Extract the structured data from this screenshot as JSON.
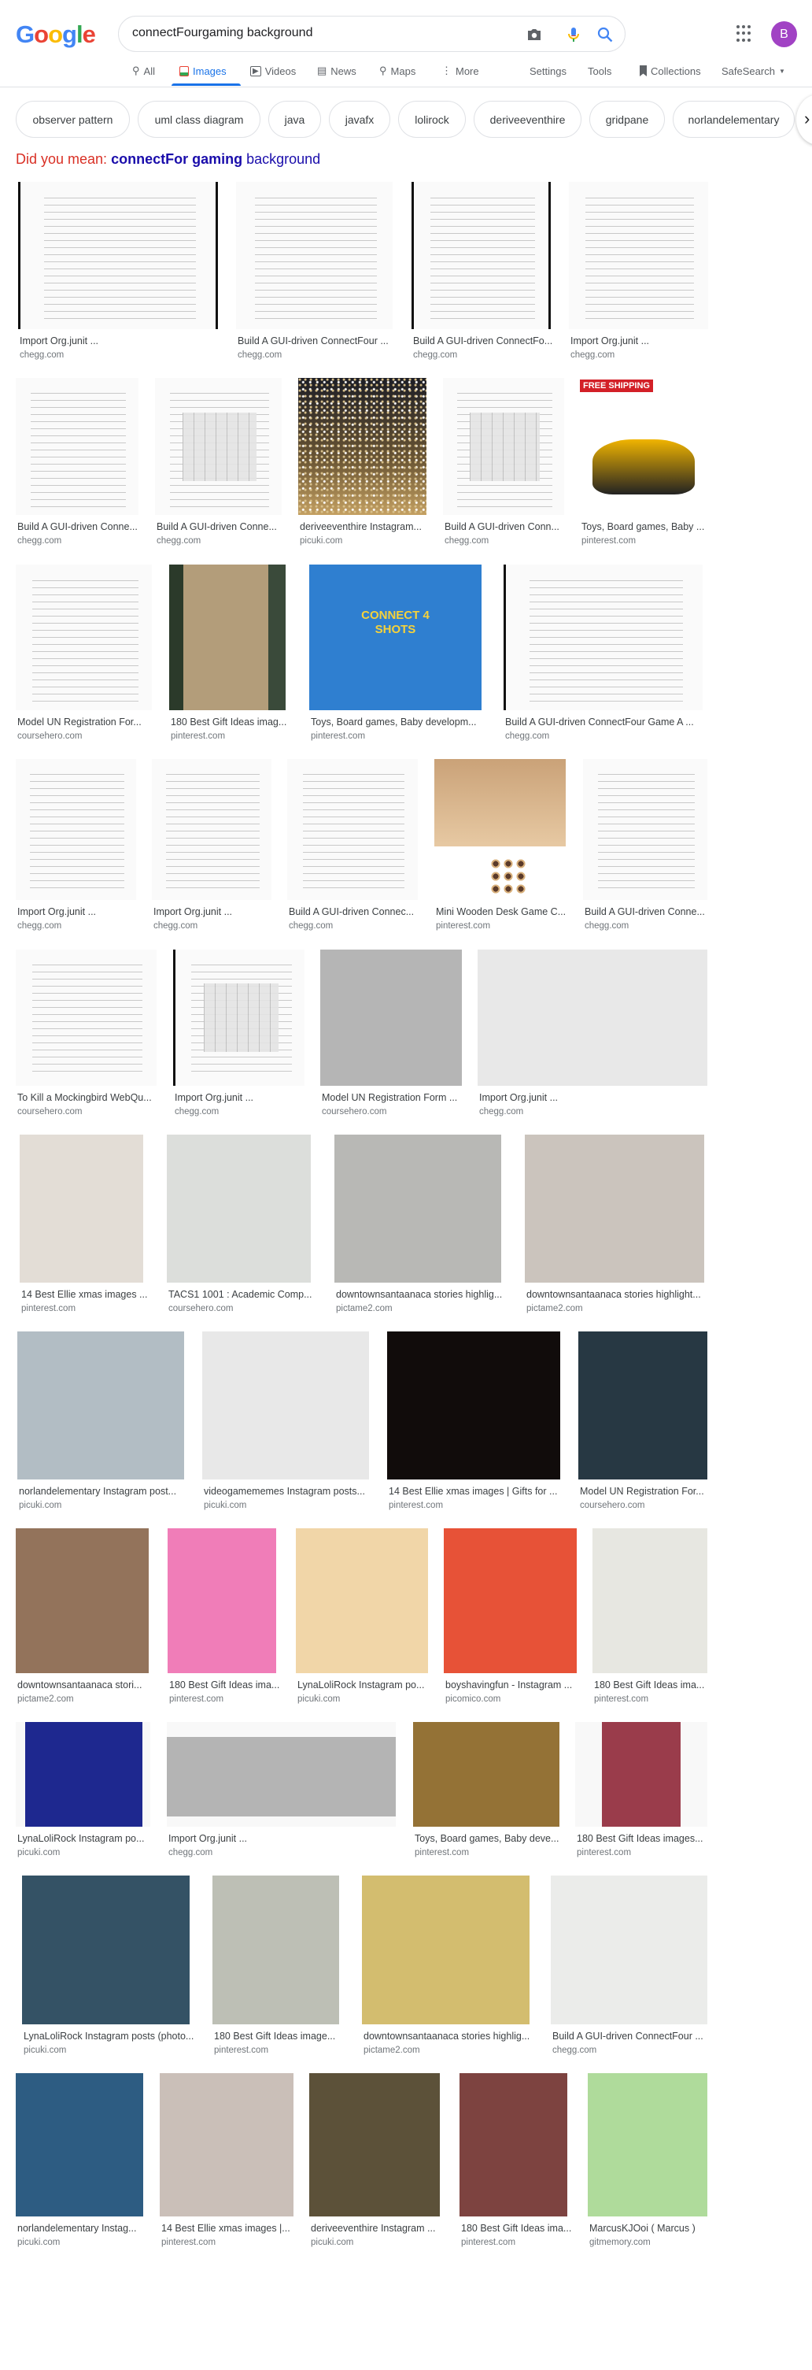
{
  "header": {
    "logo": [
      "G",
      "o",
      "o",
      "g",
      "l",
      "e"
    ],
    "logo_colors": [
      "#4285f4",
      "#ea4335",
      "#fbbc05",
      "#4285f4",
      "#34a853",
      "#ea4335"
    ],
    "search_query": "connectFourgaming background",
    "avatar_letter": "B",
    "avatar_color": "#a142c4"
  },
  "tabs": [
    {
      "label": "All",
      "icon": "search-icon"
    },
    {
      "label": "Images",
      "icon": "image-icon",
      "active": true
    },
    {
      "label": "Videos",
      "icon": "play-icon"
    },
    {
      "label": "News",
      "icon": "news-icon"
    },
    {
      "label": "Maps",
      "icon": "map-pin-icon"
    },
    {
      "label": "More",
      "icon": "more-vert-icon"
    }
  ],
  "tools": {
    "settings": "Settings",
    "tools": "Tools",
    "collections": "Collections",
    "safesearch": "SafeSearch"
  },
  "chips": [
    "observer pattern",
    "uml class diagram",
    "java",
    "javafx",
    "lolirock",
    "deriveeventhire",
    "gridpane",
    "norlandelementary"
  ],
  "did_you_mean": {
    "prefix": "Did you mean:",
    "bold": "connectFor gaming",
    "rest": "background"
  },
  "rows": [
    [
      {
        "title": "Import Org.junit ...",
        "source": "chegg.com",
        "kind": "doc bl br"
      },
      {
        "title": "Build A GUI-driven ConnectFour ...",
        "source": "chegg.com",
        "kind": "doc"
      },
      {
        "title": "Build A GUI-driven ConnectFo...",
        "source": "chegg.com",
        "kind": "doc bl br"
      },
      {
        "title": "Import Org.junit ...",
        "source": "chegg.com",
        "kind": "doc"
      }
    ],
    [
      {
        "title": "Build A GUI-driven Conne...",
        "source": "chegg.com",
        "kind": "doc"
      },
      {
        "title": "Build A GUI-driven Conne...",
        "source": "chegg.com",
        "kind": "doc grid"
      },
      {
        "title": "deriveeventhire Instagram...",
        "source": "picuki.com",
        "kind": "sparkle"
      },
      {
        "title": "Build A GUI-driven Conn...",
        "source": "chegg.com",
        "kind": "doc grid"
      },
      {
        "title": "Toys, Board games, Baby ...",
        "source": "pinterest.com",
        "kind": "toy"
      }
    ],
    [
      {
        "title": "Model UN Registration For...",
        "source": "coursehero.com",
        "kind": "doc"
      },
      {
        "title": "180 Best Gift Ideas imag...",
        "source": "pinterest.com",
        "kind": "bag"
      },
      {
        "title": "Toys, Board games, Baby developm...",
        "source": "pinterest.com",
        "kind": "game"
      },
      {
        "title": "Build A GUI-driven ConnectFour Game A ...",
        "source": "chegg.com",
        "kind": "doc bl"
      }
    ],
    [
      {
        "title": "Import Org.junit ...",
        "source": "chegg.com",
        "kind": "doc"
      },
      {
        "title": "Import Org.junit ...",
        "source": "chegg.com",
        "kind": "doc"
      },
      {
        "title": "Build A GUI-driven Connec...",
        "source": "chegg.com",
        "kind": "doc"
      },
      {
        "title": "Mini Wooden Desk Game C...",
        "source": "pinterest.com",
        "kind": "wood"
      },
      {
        "title": "Build A GUI-driven Conne...",
        "source": "chegg.com",
        "kind": "doc"
      }
    ],
    [
      {
        "title": "To Kill a Mockingbird WebQu...",
        "source": "coursehero.com",
        "kind": "doc"
      },
      {
        "title": "Import Org.junit ...",
        "source": "chegg.com",
        "kind": "doc grid bl"
      },
      {
        "title": "Model UN Registration Form ...",
        "source": "coursehero.com",
        "color": "#b5b5b5"
      },
      {
        "title": "Import Org.junit ...",
        "source": "chegg.com",
        "color": "#e8e8e8"
      }
    ],
    [
      {
        "title": "14 Best Ellie xmas images ...",
        "source": "pinterest.com",
        "color": "#e3ddd6"
      },
      {
        "title": "TACS1 1001 : Academic Comp...",
        "source": "coursehero.com",
        "color": "#dcdedb"
      },
      {
        "title": "downtownsantaanaca stories highlig...",
        "source": "pictame2.com",
        "color": "#b8b8b5"
      },
      {
        "title": "downtownsantaanaca stories highlight...",
        "source": "pictame2.com",
        "color": "#cbc4bd"
      }
    ],
    [
      {
        "title": "norlandelementary Instagram post...",
        "source": "picuki.com",
        "color": "#b2bdc4"
      },
      {
        "title": "videogamememes Instagram posts...",
        "source": "picuki.com",
        "color": "#e8e8e8"
      },
      {
        "title": "14 Best Ellie xmas images | Gifts for ...",
        "source": "pinterest.com",
        "color": "#110c0b"
      },
      {
        "title": "Model UN Registration For...",
        "source": "coursehero.com",
        "color": "#273843"
      }
    ],
    [
      {
        "title": "downtownsantaanaca stori...",
        "source": "pictame2.com",
        "color": "#93735b"
      },
      {
        "title": "180 Best Gift Ideas ima...",
        "source": "pinterest.com",
        "color": "#f07db8"
      },
      {
        "title": "LynaLoliRock Instagram po...",
        "source": "picuki.com",
        "color": "#f1d6a8"
      },
      {
        "title": "boyshavingfun - Instagram ...",
        "source": "picomico.com",
        "color": "#e75237"
      },
      {
        "title": "180 Best Gift Ideas ima...",
        "source": "pinterest.com",
        "color": "#e7e7e1"
      }
    ],
    [
      {
        "title": "LynaLoliRock Instagram po...",
        "source": "picuki.com",
        "color": "#1e288f",
        "inset": "v"
      },
      {
        "title": "Import Org.junit ...",
        "source": "chegg.com",
        "color": "#b4b4b4",
        "inset": "h"
      },
      {
        "title": "Toys, Board games, Baby deve...",
        "source": "pinterest.com",
        "color": "#947236"
      },
      {
        "title": "180 Best Gift Ideas images...",
        "source": "pinterest.com",
        "color": "#9a3c4b",
        "inset": "v2"
      }
    ],
    [
      {
        "title": "LynaLoliRock Instagram posts (photo...",
        "source": "picuki.com",
        "color": "#345265"
      },
      {
        "title": "180 Best Gift Ideas image...",
        "source": "pinterest.com",
        "color": "#bdbfb5"
      },
      {
        "title": "downtownsantaanaca stories highlig...",
        "source": "pictame2.com",
        "color": "#d3bd6f"
      },
      {
        "title": "Build A GUI-driven ConnectFour ...",
        "source": "chegg.com",
        "color": "#ebecea"
      }
    ],
    [
      {
        "title": "norlandelementary Instag...",
        "source": "picuki.com",
        "color": "#2d5c82"
      },
      {
        "title": "14 Best Ellie xmas images |...",
        "source": "pinterest.com",
        "color": "#cabfb8"
      },
      {
        "title": "deriveeventhire Instagram ...",
        "source": "picuki.com",
        "color": "#5c5139"
      },
      {
        "title": "180 Best Gift Ideas ima...",
        "source": "pinterest.com",
        "color": "#7d4340"
      },
      {
        "title": "MarcusKJOoi ( Marcus )",
        "source": "gitmemory.com",
        "color": "#afdb9b"
      }
    ]
  ]
}
